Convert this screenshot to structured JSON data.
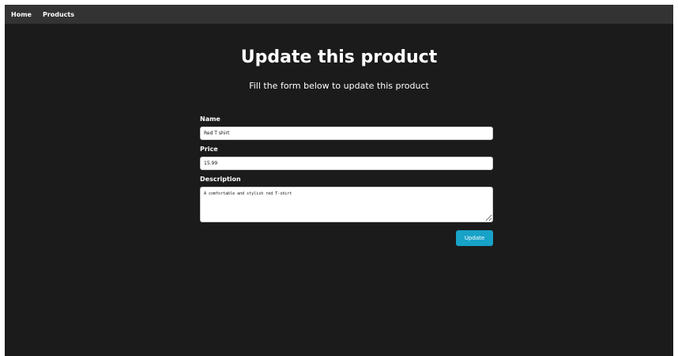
{
  "navbar": {
    "items": [
      {
        "label": "Home"
      },
      {
        "label": "Products"
      }
    ]
  },
  "main": {
    "title": "Update this product",
    "subtitle": "Fill the form below to update this product"
  },
  "form": {
    "name": {
      "label": "Name",
      "value": "Red T shirt"
    },
    "price": {
      "label": "Price",
      "value": "15.99"
    },
    "description": {
      "label": "Description",
      "value": "A comfortable and stylish red T-shirt"
    },
    "submit_label": "Update"
  },
  "colors": {
    "background": "#1b1b1b",
    "navbar": "#333333",
    "accent": "#17a2c8"
  }
}
